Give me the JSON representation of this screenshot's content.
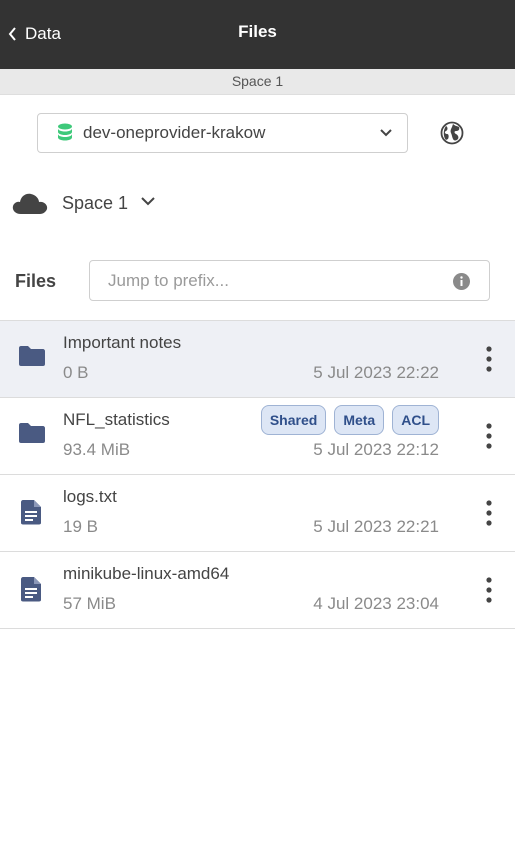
{
  "header": {
    "back_label": "Data",
    "title": "Files"
  },
  "space_bar": {
    "name": "Space 1"
  },
  "provider": {
    "selected": "dev-oneprovider-krakow",
    "icon": "database-icon",
    "icon_color": "#3ec97a"
  },
  "space_selector": {
    "label": "Space 1",
    "icon": "cloud-icon"
  },
  "files_section": {
    "label": "Files",
    "jump_placeholder": "Jump to prefix..."
  },
  "files": [
    {
      "name": "Important notes",
      "size": "0 B",
      "modified": "5 Jul 2023 22:22",
      "type": "folder",
      "tags": []
    },
    {
      "name": "NFL_statistics",
      "size": "93.4 MiB",
      "modified": "5 Jul 2023 22:12",
      "type": "folder",
      "tags": [
        "Shared",
        "Meta",
        "ACL"
      ]
    },
    {
      "name": "logs.txt",
      "size": "19 B",
      "modified": "5 Jul 2023 22:21",
      "type": "file",
      "tags": []
    },
    {
      "name": "minikube-linux-amd64",
      "size": "57 MiB",
      "modified": "4 Jul 2023 23:04",
      "type": "file",
      "tags": []
    }
  ],
  "colors": {
    "topbar": "#333333",
    "icon": "#4a5a82",
    "tag_bg": "#dde6f5",
    "tag_text": "#2f4f8a"
  }
}
